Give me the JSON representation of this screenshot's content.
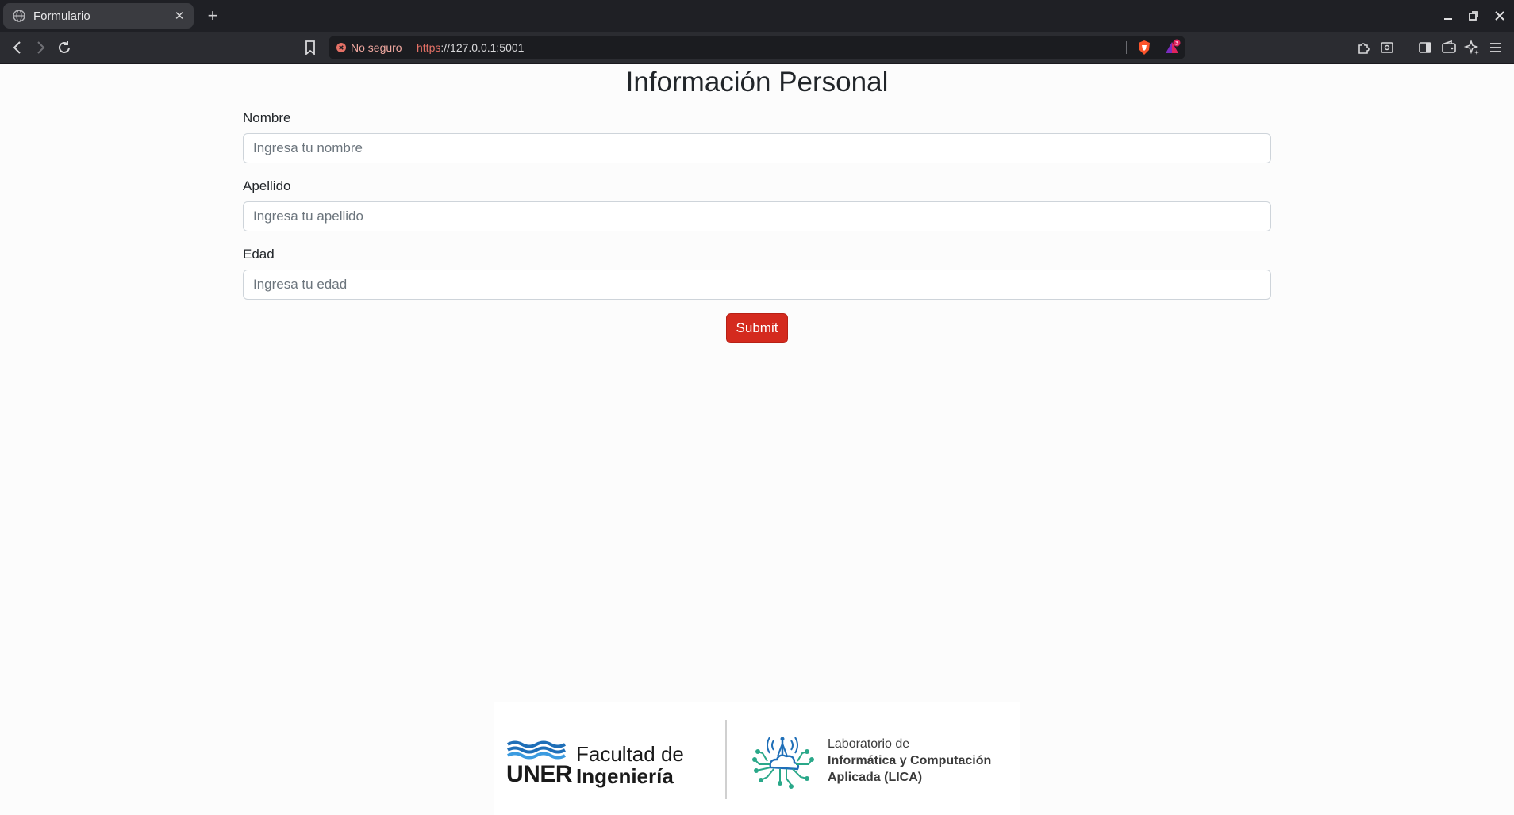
{
  "browser": {
    "tab_title": "Formulario",
    "tab_close": "✕",
    "new_tab": "+",
    "security_label": "No seguro",
    "url_scheme": "https",
    "url_rest": "://127.0.0.1:5001",
    "notification_count": "3"
  },
  "form": {
    "heading": "Información Personal",
    "fields": [
      {
        "label": "Nombre",
        "placeholder": "Ingresa tu nombre",
        "value": ""
      },
      {
        "label": "Apellido",
        "placeholder": "Ingresa tu apellido",
        "value": ""
      },
      {
        "label": "Edad",
        "placeholder": "Ingresa tu edad",
        "value": ""
      }
    ],
    "submit_label": "Submit"
  },
  "footer": {
    "uner_logo_text": "UNER",
    "faculty_line1": "Facultad de",
    "faculty_line2": "Ingeniería",
    "lab_line1": "Laboratorio de",
    "lab_line2": "Informática y Computación",
    "lab_line3": "Aplicada (LICA)"
  },
  "colors": {
    "accent": "#d42a1e",
    "insecure": "#e57166",
    "uner_blue": "#1f6fb8",
    "lica_teal": "#2aa889",
    "lica_blue": "#1f6fb8"
  }
}
